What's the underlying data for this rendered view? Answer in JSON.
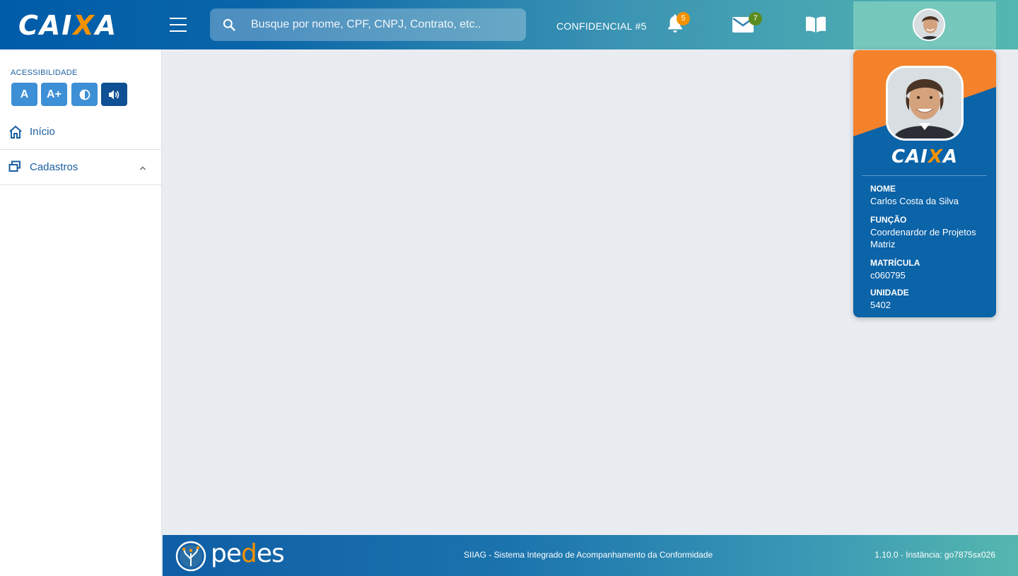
{
  "header": {
    "logo_prefix": "CAI",
    "logo_x": "X",
    "logo_suffix": "A",
    "search_placeholder": "Busque por nome, CPF, CNPJ, Contrato, etc..",
    "confidential_label": "CONFIDENCIAL #5",
    "notifications_count": "5",
    "messages_count": "7"
  },
  "sidebar": {
    "accessibility_title": "ACESSIBILIDADE",
    "accessibility_buttons": [
      "A",
      "A+",
      "◐",
      "🔊"
    ],
    "items": [
      {
        "label": "Início",
        "icon": "home-icon"
      },
      {
        "label": "Cadastros",
        "icon": "windows-icon"
      }
    ]
  },
  "profile": {
    "brand_prefix": "CAI",
    "brand_x": "X",
    "brand_suffix": "A",
    "name_label": "NOME",
    "name": "Carlos Costa da Silva",
    "role_label": "FUNÇÃO",
    "role": "Coordenardor de Projetos Matriz",
    "id_label": "MATRÍCULA",
    "id": "c060795",
    "unit_label": "UNIDADE",
    "unit": "5402"
  },
  "footer": {
    "brand_pe": "pe",
    "brand_d": "d",
    "brand_es": "es",
    "system": "SIIAG  - Sistema Integrado de Acompanhamento da Conformidade",
    "version": "1.10.0 - Instância: go7875sx026"
  },
  "colors": {
    "brand_blue": "#005ca9",
    "brand_orange": "#f39200",
    "accent_teal": "#54b8b0",
    "badge_orange": "#f39200",
    "badge_green": "#5b8c1f"
  }
}
